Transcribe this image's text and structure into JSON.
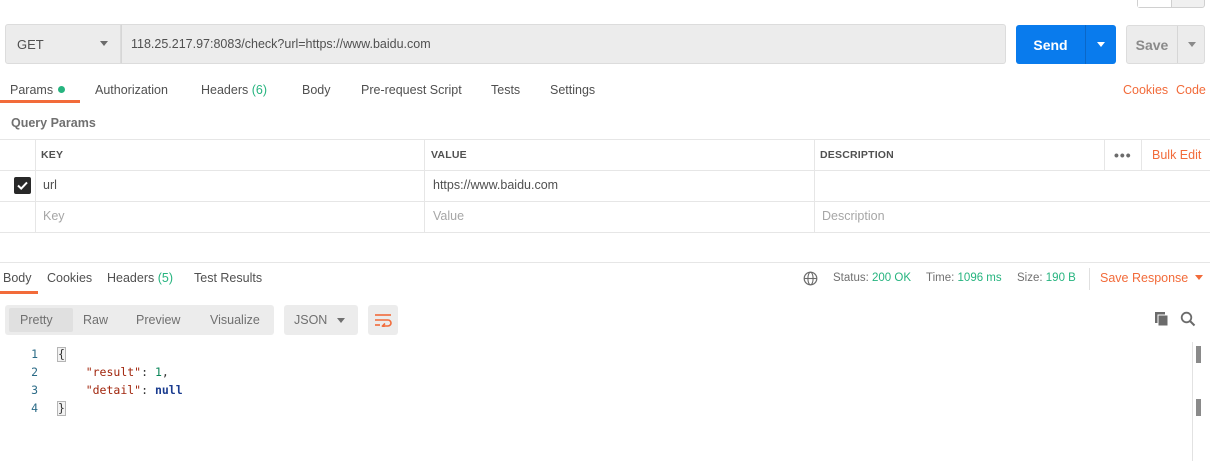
{
  "request": {
    "method": "GET",
    "url": "118.25.217.97:8083/check?url=https://www.baidu.com",
    "send_label": "Send",
    "save_label": "Save"
  },
  "request_tabs": [
    {
      "label": "Params",
      "active": true,
      "has_dot": true
    },
    {
      "label": "Authorization"
    },
    {
      "label": "Headers",
      "count": "(6)"
    },
    {
      "label": "Body"
    },
    {
      "label": "Pre-request Script"
    },
    {
      "label": "Tests"
    },
    {
      "label": "Settings"
    }
  ],
  "links": {
    "cookies": "Cookies",
    "code": "Code"
  },
  "query_params": {
    "title": "Query Params",
    "headers": {
      "key": "KEY",
      "value": "VALUE",
      "description": "DESCRIPTION"
    },
    "bulk_edit": "Bulk Edit",
    "rows": [
      {
        "checked": true,
        "key": "url",
        "value": "https://www.baidu.com",
        "description": ""
      }
    ],
    "placeholders": {
      "key": "Key",
      "value": "Value",
      "description": "Description"
    }
  },
  "response": {
    "tabs": [
      {
        "label": "Body",
        "active": true
      },
      {
        "label": "Cookies"
      },
      {
        "label": "Headers",
        "count": "(5)"
      },
      {
        "label": "Test Results"
      }
    ],
    "status_label": "Status:",
    "status_value": "200 OK",
    "time_label": "Time:",
    "time_value": "1096 ms",
    "size_label": "Size:",
    "size_value": "190 B",
    "save_response": "Save Response",
    "view_modes": [
      "Pretty",
      "Raw",
      "Preview",
      "Visualize"
    ],
    "active_view": "Pretty",
    "format": "JSON",
    "line_numbers": [
      "1",
      "2",
      "3",
      "4"
    ],
    "json_body": {
      "open": "{",
      "result_key": "\"result\"",
      "result_value": "1",
      "detail_key": "\"detail\"",
      "detail_value": "null",
      "close": "}"
    }
  },
  "colors": {
    "accent": "#f26b3a",
    "send_blue": "#097bed",
    "success_green": "#26b47f"
  },
  "icons": [
    "chevron-down-icon",
    "globe-icon",
    "wrap-lines-icon",
    "copy-icon",
    "search-icon",
    "more-icon",
    "checkbox-checked-icon"
  ]
}
